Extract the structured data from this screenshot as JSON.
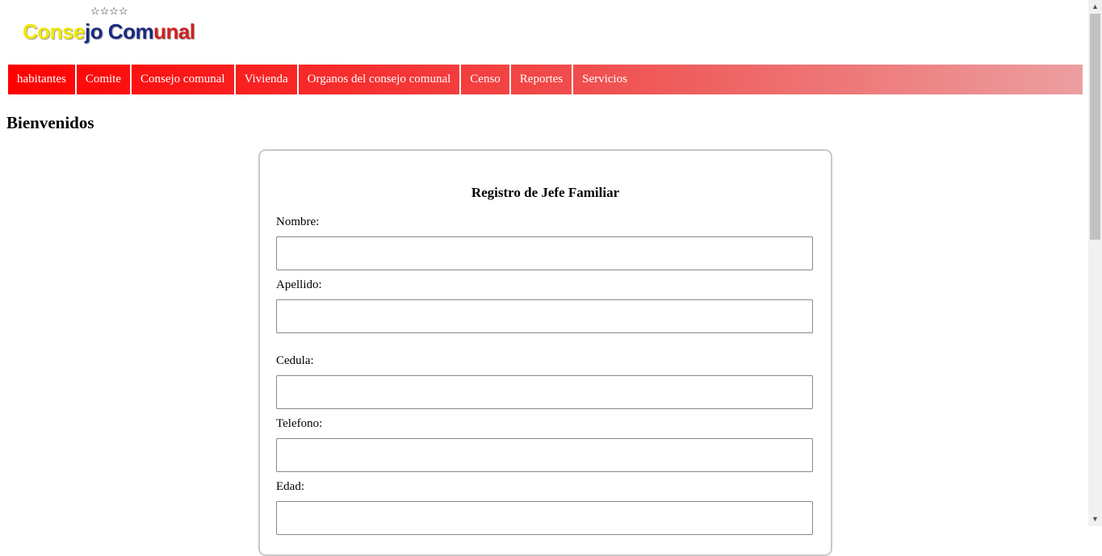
{
  "logo": {
    "text_part1": "Conse",
    "text_part2": "jo Com",
    "text_part3": "unal",
    "stars": "☆☆☆☆"
  },
  "nav": [
    "habitantes",
    "Comite",
    "Consejo comunal",
    "Vivienda",
    "Organos del consejo comunal",
    "Censo",
    "Reportes",
    "Servicios"
  ],
  "heading": "Bienvenidos",
  "form": {
    "title": "Registro de Jefe Familiar",
    "fields": [
      "Nombre:",
      "Apellido:",
      "Cedula:",
      "Telefono:",
      "Edad:"
    ]
  }
}
